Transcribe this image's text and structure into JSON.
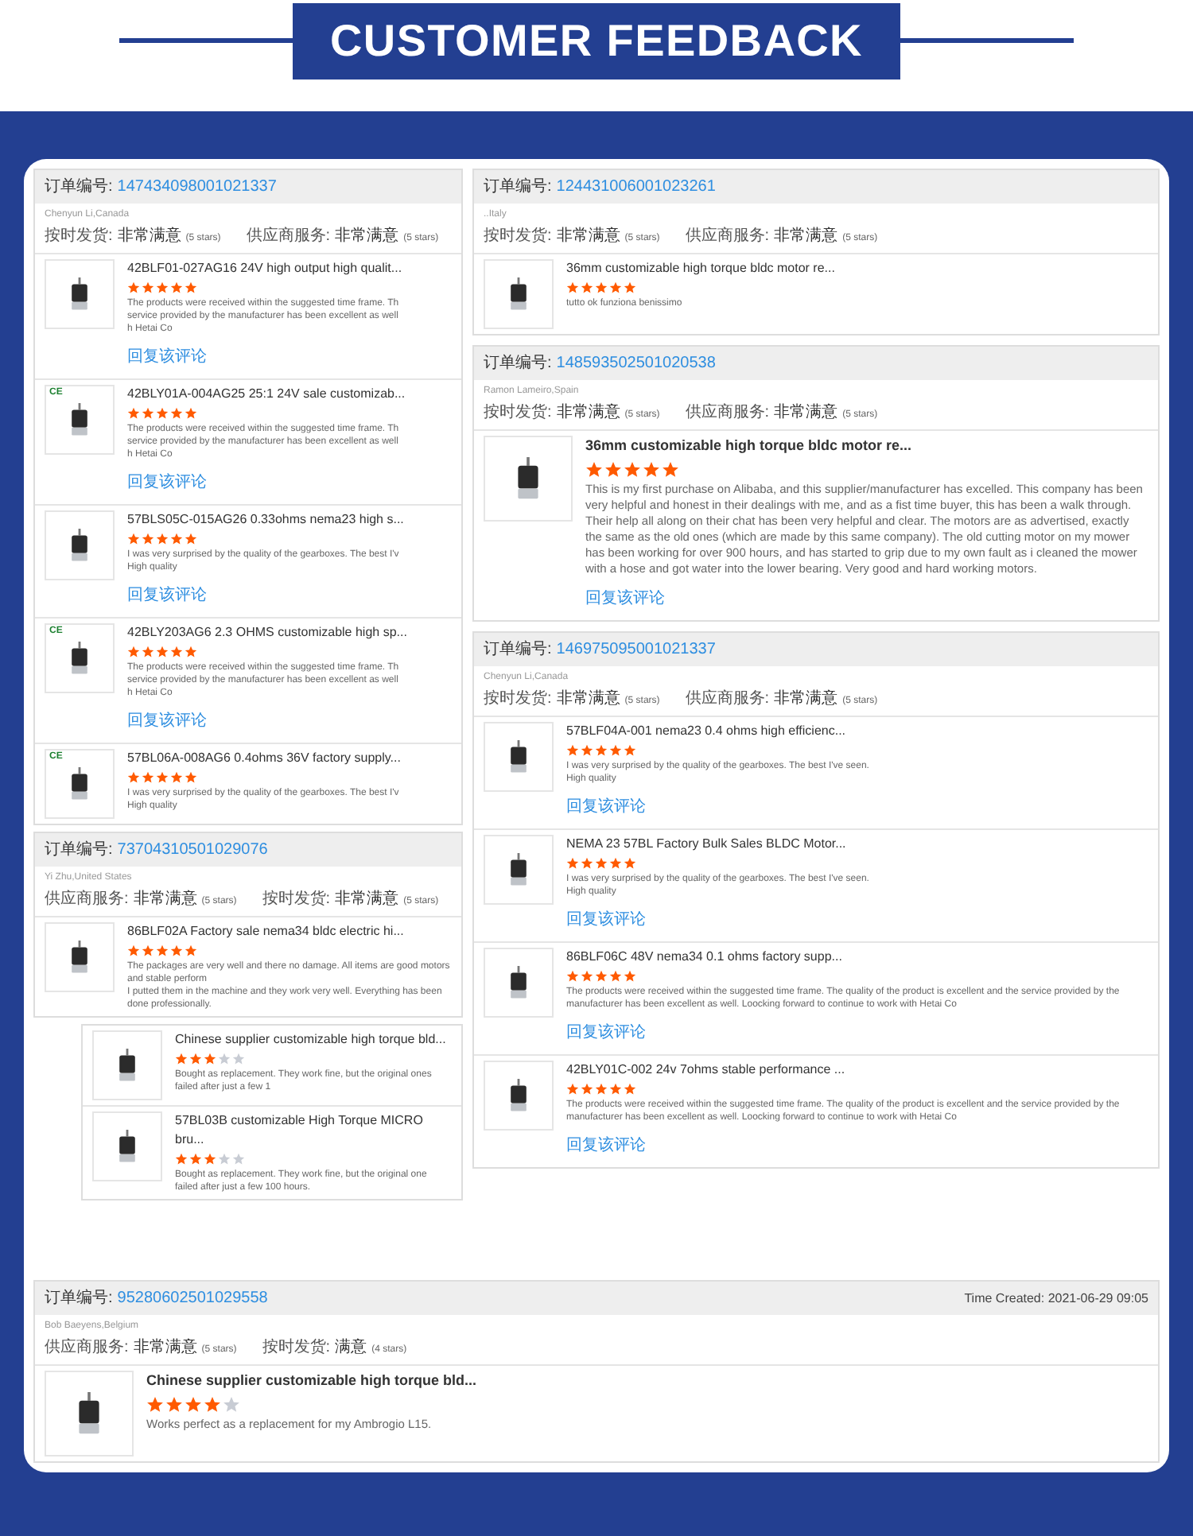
{
  "header": {
    "title": "CUSTOMER FEEDBACK"
  },
  "left_column": [
    {
      "order_label": "订单编号:",
      "order_number": "147434098001021337",
      "buyer": "Chenyun Li,Canada",
      "ratings": [
        {
          "label": "按时发货:",
          "value": "非常满意",
          "note": "(5 stars)"
        },
        {
          "label": "供应商服务:",
          "value": "非常满意",
          "note": "(5 stars)"
        }
      ],
      "items": [
        {
          "title": "42BLF01-027AG16 24V high output high qualit...",
          "stars": 5,
          "review": [
            "The products were received within the suggested time frame. Th",
            "service provided by the manufacturer has been excellent as well",
            "h Hetai Co"
          ],
          "reply": "回复该评论"
        },
        {
          "badge": "CE",
          "title": "42BLY01A-004AG25 25:1 24V sale customizab...",
          "stars": 5,
          "review": [
            "The products were received within the suggested time frame. Th",
            "service provided by the manufacturer has been excellent as well",
            "h Hetai Co"
          ],
          "reply": "回复该评论"
        },
        {
          "title": "57BLS05C-015AG26 0.33ohms nema23 high s...",
          "stars": 5,
          "review": [
            "I was very surprised by the quality of the gearboxes. The best I'v",
            "High quality"
          ],
          "reply": "回复该评论"
        },
        {
          "badge": "CE",
          "title": "42BLY203AG6 2.3 OHMS customizable high sp...",
          "stars": 5,
          "review": [
            "The products were received within the suggested time frame. Th",
            "service provided by the manufacturer has been excellent as well",
            "h Hetai Co"
          ],
          "reply": "回复该评论"
        },
        {
          "badge": "CE",
          "title": "57BL06A-008AG6 0.4ohms 36V factory supply...",
          "stars": 5,
          "review": [
            "I was very surprised by the quality of the gearboxes. The best I'v",
            "High quality"
          ]
        }
      ]
    },
    {
      "order_label": "订单编号:",
      "order_number": "73704310501029076",
      "buyer": "Yi Zhu,United States",
      "ratings": [
        {
          "label": "供应商服务:",
          "value": "非常满意",
          "note": "(5 stars)"
        },
        {
          "label": "按时发货:",
          "value": "非常满意",
          "note": "(5 stars)"
        }
      ],
      "items": [
        {
          "title": "86BLF02A Factory sale nema34 bldc electric hi...",
          "stars": 5,
          "review": [
            "The packages are very well and there no damage. All items are good motors and stable perform",
            "I putted them in the machine and they work very well. Everything has been done professionally."
          ]
        }
      ]
    },
    {
      "items": [
        {
          "title": "Chinese supplier customizable high torque bld...",
          "stars": 3,
          "review": [
            "Bought as replacement. They work fine, but the original ones failed after just a few 1"
          ]
        },
        {
          "title": "57BL03B customizable High Torque MICRO bru...",
          "stars": 3,
          "review": [
            "Bought as replacement. They work fine, but the original one failed after just a few 100 hours."
          ]
        }
      ]
    }
  ],
  "right_column": [
    {
      "order_label": "订单编号:",
      "order_number": "124431006001023261",
      "buyer": "..Italy",
      "ratings": [
        {
          "label": "按时发货:",
          "value": "非常满意",
          "note": "(5 stars)"
        },
        {
          "label": "供应商服务:",
          "value": "非常满意",
          "note": "(5 stars)"
        }
      ],
      "items": [
        {
          "title": "36mm customizable high torque bldc motor re...",
          "stars": 5,
          "review": [
            "tutto ok funziona benissimo"
          ]
        }
      ]
    },
    {
      "order_label": "订单编号:",
      "order_number": "148593502501020538",
      "buyer": "Ramon Lameiro,Spain",
      "ratings": [
        {
          "label": "按时发货:",
          "value": "非常满意",
          "note": "(5 stars)"
        },
        {
          "label": "供应商服务:",
          "value": "非常满意",
          "note": "(5 stars)"
        }
      ],
      "items": [
        {
          "title": "36mm customizable high torque bldc motor re...",
          "stars": 5,
          "review": [
            "This is my first purchase on Alibaba, and this supplier/manufacturer has excelled. This company has been very helpful and honest in their dealings with me, and as a fist time buyer, this has been a walk through. Their help all along on their chat has been very helpful and clear. The motors are as advertised, exactly the same as the old ones (which are made by this same company). The old cutting motor on my mower has been working for over 900 hours, and has started to grip due to my own fault as i cleaned the mower with a hose and got water into the lower bearing. Very good and hard working motors."
          ],
          "reply": "回复该评论"
        }
      ]
    },
    {
      "order_label": "订单编号:",
      "order_number": "146975095001021337",
      "buyer": "Chenyun Li,Canada",
      "ratings": [
        {
          "label": "按时发货:",
          "value": "非常满意",
          "note": "(5 stars)"
        },
        {
          "label": "供应商服务:",
          "value": "非常满意",
          "note": "(5 stars)"
        }
      ],
      "items": [
        {
          "title": "57BLF04A-001 nema23 0.4 ohms high efficienc...",
          "stars": 5,
          "review": [
            "I was very surprised by the quality of the gearboxes. The best I've seen.",
            "High quality"
          ],
          "reply": "回复该评论"
        },
        {
          "title": "NEMA 23 57BL Factory Bulk Sales BLDC Motor...",
          "stars": 5,
          "review": [
            "I was very surprised by the quality of the gearboxes. The best I've seen.",
            "High quality"
          ],
          "reply": "回复该评论"
        },
        {
          "title": "86BLF06C 48V nema34 0.1 ohms factory supp...",
          "stars": 5,
          "review": [
            "The products were received within the suggested time frame. The quality of the product is excellent and the service provided by the manufacturer has been excellent as well. Loocking forward to continue to work with Hetai Co"
          ],
          "reply": "回复该评论"
        },
        {
          "title": "42BLY01C-002 24v 7ohms stable performance ...",
          "stars": 5,
          "review": [
            "The products were received within the suggested time frame. The quality of the product is excellent and the service provided by the manufacturer has been excellent as well. Loocking forward to continue to work with Hetai Co"
          ],
          "reply": "回复该评论"
        }
      ]
    }
  ],
  "bottom": [
    {
      "order_label": "订单编号:",
      "order_number": "95280602501029558",
      "time_created": "Time Created: 2021-06-29 09:05",
      "buyer": "Bob Baeyens,Belgium",
      "ratings": [
        {
          "label": "供应商服务:",
          "value": "非常满意",
          "note": "(5 stars)"
        },
        {
          "label": "按时发货:",
          "value": "满意",
          "note": "(4 stars)"
        }
      ],
      "items": [
        {
          "title": "Chinese supplier customizable high torque bld...",
          "stars": 4,
          "review": [
            "Works perfect as a replacement for my Ambrogio L15."
          ]
        }
      ]
    }
  ]
}
